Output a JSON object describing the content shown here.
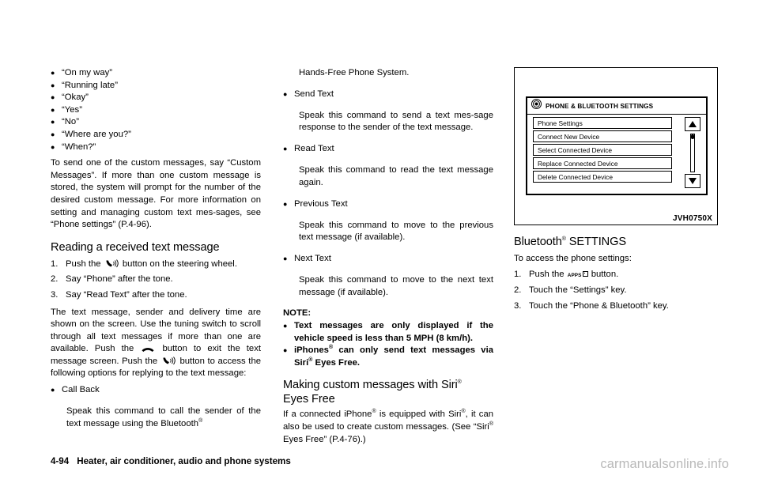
{
  "page": {
    "number": "4-94",
    "footer_title": "Heater, air conditioner, audio and phone systems",
    "watermark": "carmanualsonline.info"
  },
  "column1": {
    "quick_messages": [
      "“On my way”",
      "“Running late”",
      "“Okay”",
      "“Yes”",
      "“No”",
      "“Where are you?”",
      "“When?”"
    ],
    "custom_messages_paragraph": "To send one of the custom messages, say “Custom Messages”. If more than one custom message is stored, the system will prompt for the number of the desired custom message. For more information on setting and managing custom text mes-sages, see “Phone settings” (P.4-96).",
    "heading_reading": "Reading a received text message",
    "steps": [
      {
        "num": "1.",
        "before": "Push the",
        "icon": "phone-talk-icon",
        "after": "button on the steering wheel."
      },
      {
        "num": "2.",
        "before": "Say “Phone” after the tone.",
        "icon": "",
        "after": ""
      },
      {
        "num": "3.",
        "before": "Say “Read Text” after the tone.",
        "icon": "",
        "after": ""
      }
    ],
    "reading_paragraph_part1": "The text message, sender and delivery time are shown on the screen. Use the tuning switch to scroll through all text messages if more than one are available. Push the",
    "reading_paragraph_part2": "button to exit the text message screen. Push the",
    "reading_paragraph_part3": "button to access the following options for replying to the text message:",
    "option_call_back_label": "Call Back",
    "option_call_back_text": "Speak this command to call the sender of the text message using the Bluetooth"
  },
  "column2": {
    "continuation": "Hands-Free Phone System.",
    "options": [
      {
        "label": "Send Text",
        "text": "Speak this command to send a text mes-sage response to the sender of the text message."
      },
      {
        "label": "Read Text",
        "text": "Speak this command to read the text message again."
      },
      {
        "label": "Previous Text",
        "text": "Speak this command to move to the previous text message (if available)."
      },
      {
        "label": "Next Text",
        "text": "Speak this command to move to the next text message (if available)."
      }
    ],
    "note_heading": "NOTE:",
    "notes": [
      "Text messages are only displayed if the vehicle speed is less than 5 MPH (8 km/h).",
      "iPhones® can only send text messages via Siri® Eyes Free."
    ],
    "note_items": [
      {
        "pre": "Text messages are only displayed if the vehicle speed is less than 5 MPH (8 km/h).",
        "kind": "plain"
      },
      {
        "pre": "iPhones",
        "mid": " can only send text messages via Siri",
        "post": " Eyes Free.",
        "kind": "reg2"
      }
    ],
    "heading_siri_line1_pre": "Making custom messages with Siri",
    "heading_siri_line2": "Eyes Free",
    "siri_paragraph_part1": "If a connected iPhone",
    "siri_paragraph_part2": " is equipped with Siri",
    "siri_paragraph_part3": ", it can also be used to create custom messages. (See “Siri",
    "siri_paragraph_part4": " Eyes Free” (P.4-76).)"
  },
  "column3": {
    "figure": {
      "caption": "JVH0750X",
      "device_icon": "bluetooth-settings-dial-icon",
      "device_title": "PHONE & BLUETOOTH SETTINGS",
      "menu_items": [
        "Phone Settings",
        "Connect New Device",
        "Select Connected Device",
        "Replace Connected Device",
        "Delete Connected Device"
      ],
      "scroll_up_icon": "triangle-up-icon",
      "scroll_down_icon": "triangle-down-icon"
    },
    "heading_pre": "Bluetooth",
    "heading_post": " SETTINGS",
    "intro": "To access the phone settings:",
    "steps": [
      {
        "num": "1.",
        "before": "Push the",
        "key": "APPS",
        "after": "button."
      },
      {
        "num": "2.",
        "before": "Touch the “Settings” key.",
        "key": "",
        "after": ""
      },
      {
        "num": "3.",
        "before": "Touch the “Phone & Bluetooth” key.",
        "key": "",
        "after": ""
      }
    ]
  }
}
